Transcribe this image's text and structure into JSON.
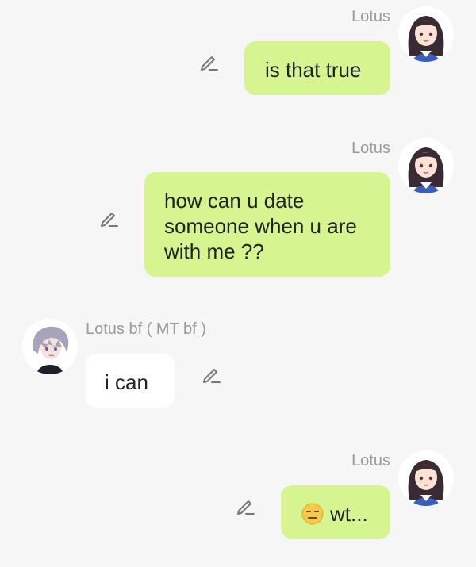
{
  "messages": [
    {
      "sender": "Lotus",
      "side": "right",
      "text": "is that true"
    },
    {
      "sender": "Lotus",
      "side": "right",
      "lines": [
        "how can u date",
        "someone when u are",
        "with me ??"
      ]
    },
    {
      "sender": "Lotus bf ( MT bf )",
      "side": "left",
      "text": "i can"
    },
    {
      "sender": "Lotus",
      "side": "right",
      "emoji": "expressionless-face-emoji",
      "text": "wt..."
    }
  ],
  "icons": {
    "edit": "pencil-edit-icon",
    "avatar_girl": "avatar-lotus",
    "avatar_boy": "avatar-lotus-bf"
  },
  "colors": {
    "background": "#f6f6f6",
    "outgoing_bubble": "#d6f48f",
    "incoming_bubble": "#ffffff",
    "sender_name": "#9a9a9a",
    "message_text": "#222222"
  }
}
